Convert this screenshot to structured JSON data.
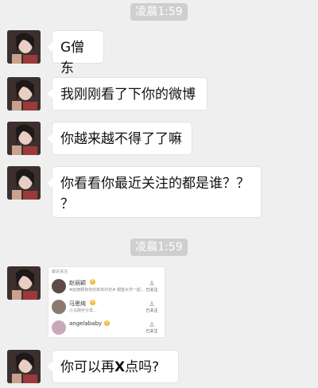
{
  "timestamps": [
    "凌晨1:59",
    "凌晨1:59"
  ],
  "messages": [
    {
      "text": "G僧东"
    },
    {
      "text": "我刚刚看了下你的微博"
    },
    {
      "text": "你越来越不得了了嘛"
    },
    {
      "line1": "你看看你最近关注的都是谁？？",
      "line2": "？"
    },
    {
      "pre": "你可以再",
      "bold": "X",
      "post": "点吗?"
    }
  ],
  "card": {
    "header": "最近关注",
    "items": [
      {
        "name": "赵丽颖",
        "sub": "#赵丽颖和你的新年约定# 期望大学一起…",
        "btn": "已关注"
      },
      {
        "name": "马思纯",
        "sub": "小马随手分享…",
        "btn": "已关注"
      },
      {
        "name": "angelababy",
        "sub": "",
        "btn": "已关注"
      }
    ]
  },
  "colors": {
    "background": "#efefef",
    "bubble": "#ffffff",
    "timestamp_bg": "#cfcfcf",
    "verified": "#f3b83a"
  },
  "icons": [
    "contact-avatar",
    "verified-badge-icon",
    "person-follow-icon"
  ]
}
